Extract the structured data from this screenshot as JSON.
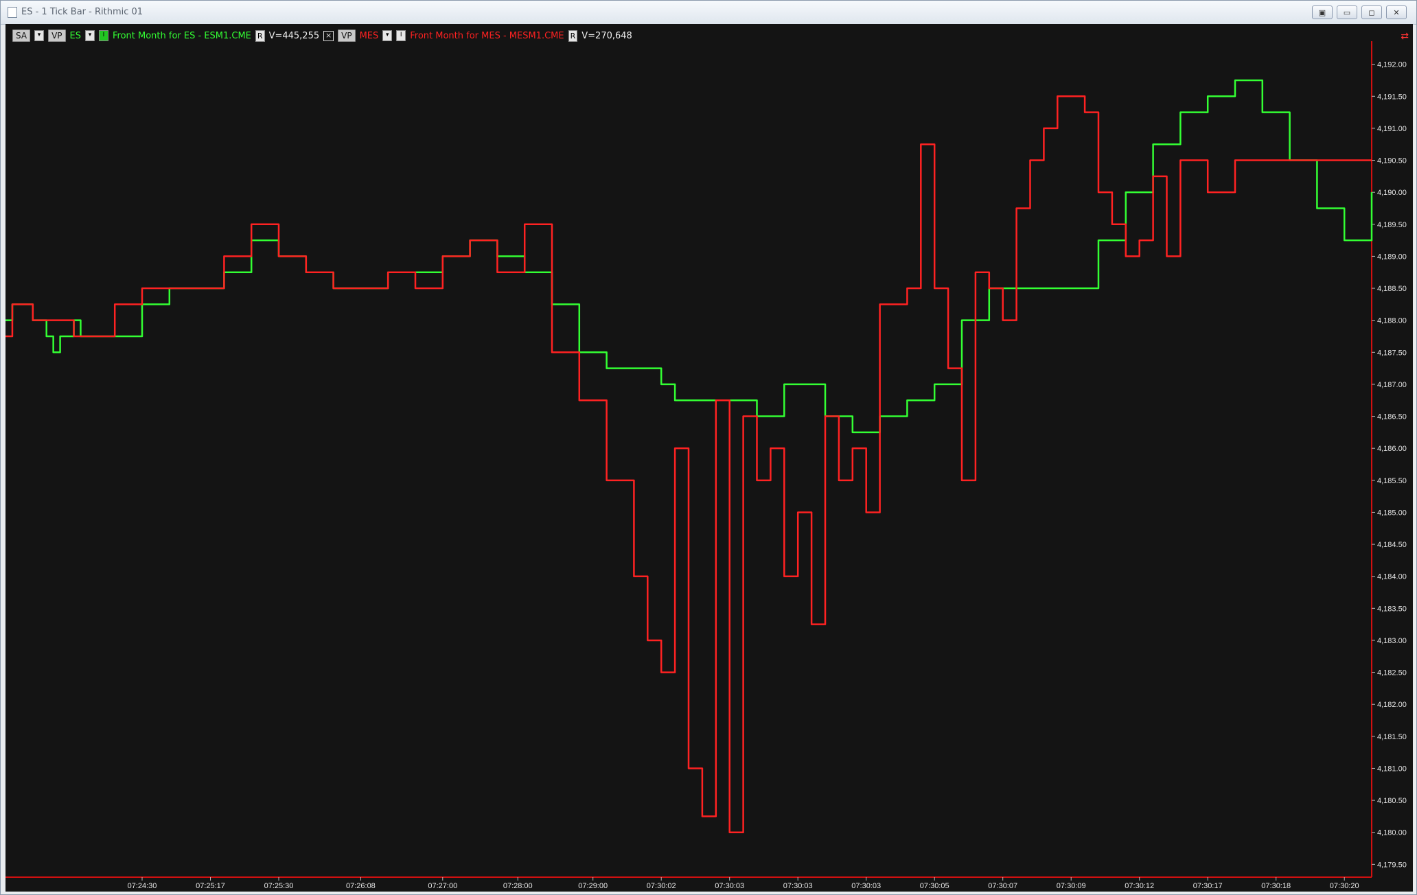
{
  "window": {
    "title": "ES - 1 Tick Bar - Rithmic 01",
    "buttons": [
      "restore-icon",
      "minimize-icon",
      "maximize-icon",
      "close-icon"
    ]
  },
  "toolbar": {
    "sa_label": "SA",
    "es": {
      "vp": "VP",
      "symbol": "ES",
      "desc": "Front Month for ES - ESM1.CME",
      "r_label": "R",
      "volume": "V=445,255",
      "color": "#33ff33"
    },
    "mes": {
      "vp": "VP",
      "symbol": "MES",
      "desc": "Front Month for MES - MESM1.CME",
      "r_label": "R",
      "volume": "V=270,648",
      "color": "#ff2222"
    }
  },
  "chart_data": {
    "type": "line",
    "y_ticks": [
      "4,192.00",
      "4,191.50",
      "4,191.00",
      "4,190.50",
      "4,190.00",
      "4,189.50",
      "4,189.00",
      "4,188.50",
      "4,188.00",
      "4,187.50",
      "4,187.00",
      "4,186.50",
      "4,186.00",
      "4,185.50",
      "4,185.00",
      "4,184.50",
      "4,184.00",
      "4,183.50",
      "4,183.00",
      "4,182.50",
      "4,182.00",
      "4,181.50",
      "4,181.00",
      "4,180.50",
      "4,180.00",
      "4,179.50"
    ],
    "ylim": [
      4179.3,
      4192.2
    ],
    "x_ticks": [
      "07:24:30",
      "07:25:17",
      "07:25:30",
      "07:26:08",
      "07:27:00",
      "07:28:00",
      "07:29:00",
      "07:30:02",
      "07:30:03",
      "07:30:03",
      "07:30:03",
      "07:30:05",
      "07:30:07",
      "07:30:09",
      "07:30:12",
      "07:30:17",
      "07:30:18",
      "07:30:20"
    ],
    "x_ticks_idx": [
      0.1,
      0.15,
      0.2,
      0.26,
      0.32,
      0.375,
      0.43,
      0.48,
      0.53,
      0.58,
      0.63,
      0.68,
      0.73,
      0.78,
      0.83,
      0.88,
      0.93,
      0.98
    ],
    "series": [
      {
        "name": "ES",
        "color": "#33ff33",
        "x": [
          0,
          0.005,
          0.015,
          0.02,
          0.03,
          0.035,
          0.04,
          0.05,
          0.055,
          0.06,
          0.08,
          0.1,
          0.12,
          0.14,
          0.16,
          0.18,
          0.2,
          0.22,
          0.24,
          0.26,
          0.28,
          0.3,
          0.32,
          0.34,
          0.36,
          0.38,
          0.4,
          0.42,
          0.44,
          0.46,
          0.47,
          0.48,
          0.49,
          0.5,
          0.52,
          0.55,
          0.57,
          0.6,
          0.62,
          0.64,
          0.66,
          0.68,
          0.7,
          0.72,
          0.74,
          0.76,
          0.78,
          0.8,
          0.82,
          0.84,
          0.86,
          0.88,
          0.9,
          0.92,
          0.94,
          0.96,
          0.98,
          1.0
        ],
        "y": [
          4188.0,
          4188.25,
          4188.25,
          4188.0,
          4187.75,
          4187.5,
          4187.75,
          4188.0,
          4187.75,
          4187.75,
          4187.75,
          4188.25,
          4188.5,
          4188.5,
          4188.75,
          4189.25,
          4189.0,
          4188.75,
          4188.5,
          4188.5,
          4188.75,
          4188.75,
          4189.0,
          4189.25,
          4189.0,
          4188.75,
          4188.25,
          4187.5,
          4187.25,
          4187.25,
          4187.25,
          4187.0,
          4186.75,
          4186.75,
          4186.75,
          4186.5,
          4187.0,
          4186.5,
          4186.25,
          4186.5,
          4186.75,
          4187.0,
          4188.0,
          4188.5,
          4188.5,
          4188.5,
          4188.5,
          4189.25,
          4190.0,
          4190.75,
          4191.25,
          4191.5,
          4191.75,
          4191.25,
          4190.5,
          4189.75,
          4189.25,
          4190.0
        ]
      },
      {
        "name": "MES",
        "color": "#ff2222",
        "x": [
          0,
          0.005,
          0.015,
          0.02,
          0.03,
          0.04,
          0.05,
          0.06,
          0.08,
          0.1,
          0.12,
          0.14,
          0.16,
          0.18,
          0.2,
          0.22,
          0.24,
          0.26,
          0.28,
          0.3,
          0.32,
          0.34,
          0.36,
          0.38,
          0.4,
          0.42,
          0.44,
          0.46,
          0.47,
          0.48,
          0.49,
          0.5,
          0.51,
          0.52,
          0.53,
          0.54,
          0.55,
          0.56,
          0.57,
          0.58,
          0.59,
          0.6,
          0.61,
          0.62,
          0.63,
          0.64,
          0.65,
          0.66,
          0.67,
          0.68,
          0.69,
          0.7,
          0.71,
          0.72,
          0.73,
          0.74,
          0.75,
          0.76,
          0.77,
          0.78,
          0.79,
          0.8,
          0.81,
          0.82,
          0.83,
          0.84,
          0.85,
          0.86,
          0.88,
          0.9,
          0.92,
          0.94,
          0.95,
          0.96,
          0.97,
          0.98,
          0.99,
          1.0
        ],
        "y": [
          4187.75,
          4188.25,
          4188.25,
          4188.0,
          4188.0,
          4188.0,
          4187.75,
          4187.75,
          4188.25,
          4188.5,
          4188.5,
          4188.5,
          4189.0,
          4189.5,
          4189.0,
          4188.75,
          4188.5,
          4188.5,
          4188.75,
          4188.5,
          4189.0,
          4189.25,
          4188.75,
          4189.5,
          4187.5,
          4186.75,
          4185.5,
          4184.0,
          4183.0,
          4182.5,
          4186.0,
          4181.0,
          4180.25,
          4186.75,
          4180.0,
          4186.5,
          4185.5,
          4186.0,
          4184.0,
          4185.0,
          4183.25,
          4186.5,
          4185.5,
          4186.0,
          4185.0,
          4188.25,
          4188.25,
          4188.5,
          4190.75,
          4188.5,
          4187.25,
          4185.5,
          4188.75,
          4188.5,
          4188.0,
          4189.75,
          4190.5,
          4191.0,
          4191.5,
          4191.5,
          4191.25,
          4190.0,
          4189.5,
          4189.0,
          4189.25,
          4190.25,
          4189.0,
          4190.5,
          4190.0,
          4190.5,
          4190.5,
          4190.5,
          4190.5,
          4190.5,
          4190.5,
          4190.5,
          4190.5,
          4190.5
        ]
      }
    ]
  }
}
